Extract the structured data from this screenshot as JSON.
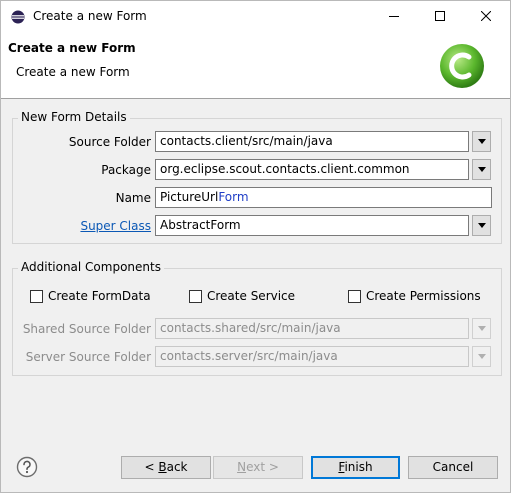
{
  "window": {
    "title": "Create a new Form"
  },
  "banner": {
    "title": "Create a new Form",
    "message": "Create a new Form"
  },
  "form_details": {
    "title": "New Form Details",
    "source_folder": {
      "label": "Source Folder",
      "value": "contacts.client/src/main/java"
    },
    "package": {
      "label": "Package",
      "value": "org.eclipse.scout.contacts.client.common"
    },
    "name": {
      "label": "Name",
      "value_prefix": "PictureUrl",
      "value_suffix": "Form"
    },
    "super_class": {
      "label": "Super Class",
      "value": "AbstractForm"
    }
  },
  "additional": {
    "title": "Additional Components",
    "create_formdata": "Create FormData",
    "create_service": "Create Service",
    "create_permissions": "Create Permissions",
    "shared_source_folder": {
      "label": "Shared Source Folder",
      "value": "contacts.shared/src/main/java"
    },
    "server_source_folder": {
      "label": "Server Source Folder",
      "value": "contacts.server/src/main/java"
    }
  },
  "buttons": {
    "back_prefix": "< ",
    "back_mnemonic": "B",
    "back_rest": "ack",
    "next_prefix": "",
    "next_mnemonic": "N",
    "next_rest": "ext >",
    "finish_mnemonic": "F",
    "finish_rest": "inish",
    "cancel": "Cancel"
  },
  "colors": {
    "accent": "#0078d7",
    "link": "#0b58b5",
    "logo_green": "#5cb82e"
  }
}
